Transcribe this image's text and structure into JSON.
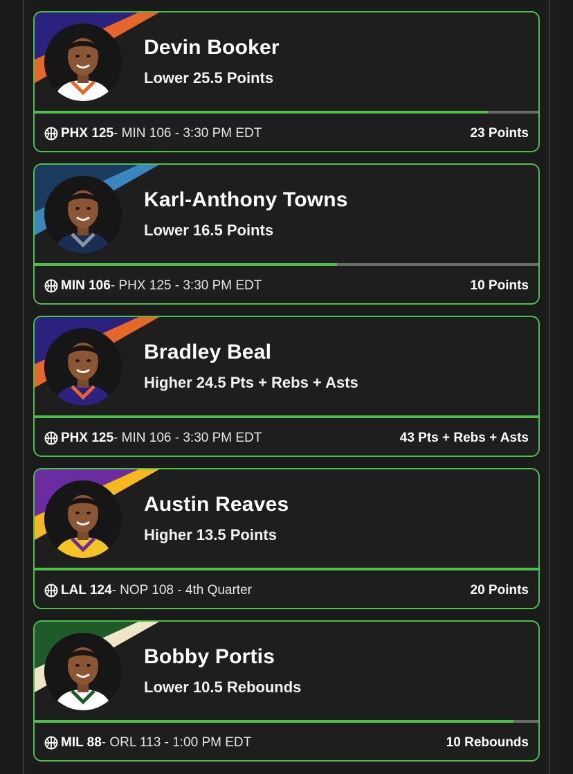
{
  "cards": [
    {
      "player": "Devin Booker",
      "pick": "Lower 25.5 Points",
      "team": "PHX 125",
      "rest": " - MIN 106 - 3:30 PM EDT",
      "result": "23 Points",
      "progress": 0.9,
      "colors": {
        "a": "#2b2280",
        "b": "#e5682a",
        "jersey": "#ffffff",
        "trim": "#e5682a"
      }
    },
    {
      "player": "Karl-Anthony Towns",
      "pick": "Lower 16.5 Points",
      "team": "MIN 106",
      "rest": " - PHX 125 - 3:30 PM EDT",
      "result": "10 Points",
      "progress": 0.6,
      "colors": {
        "a": "#1a3a5e",
        "b": "#3a87c0",
        "jersey": "#1a2e54",
        "trim": "#8b96a4"
      }
    },
    {
      "player": "Bradley Beal",
      "pick": "Higher 24.5 Pts + Rebs + Asts",
      "team": "PHX 125",
      "rest": " - MIN 106 - 3:30 PM EDT",
      "result": "43 Pts + Rebs + Asts",
      "progress": 1.0,
      "colors": {
        "a": "#2b2280",
        "b": "#e5682a",
        "jersey": "#2b2280",
        "trim": "#e5682a"
      }
    },
    {
      "player": "Austin Reaves",
      "pick": "Higher 13.5 Points",
      "team": "LAL 124",
      "rest": " - NOP 108 - 4th Quarter",
      "result": "20 Points",
      "progress": 1.0,
      "colors": {
        "a": "#6a2ca0",
        "b": "#f5b91e",
        "jersey": "#f5c324",
        "trim": "#6a2ca0"
      }
    },
    {
      "player": "Bobby Portis",
      "pick": "Lower 10.5 Rebounds",
      "team": "MIL 88",
      "rest": " - ORL 113 - 1:00 PM EDT",
      "result": "10 Rebounds",
      "progress": 0.95,
      "colors": {
        "a": "#1f5a2a",
        "b": "#efe6c8",
        "jersey": "#ffffff",
        "trim": "#1f5a2a"
      }
    }
  ]
}
